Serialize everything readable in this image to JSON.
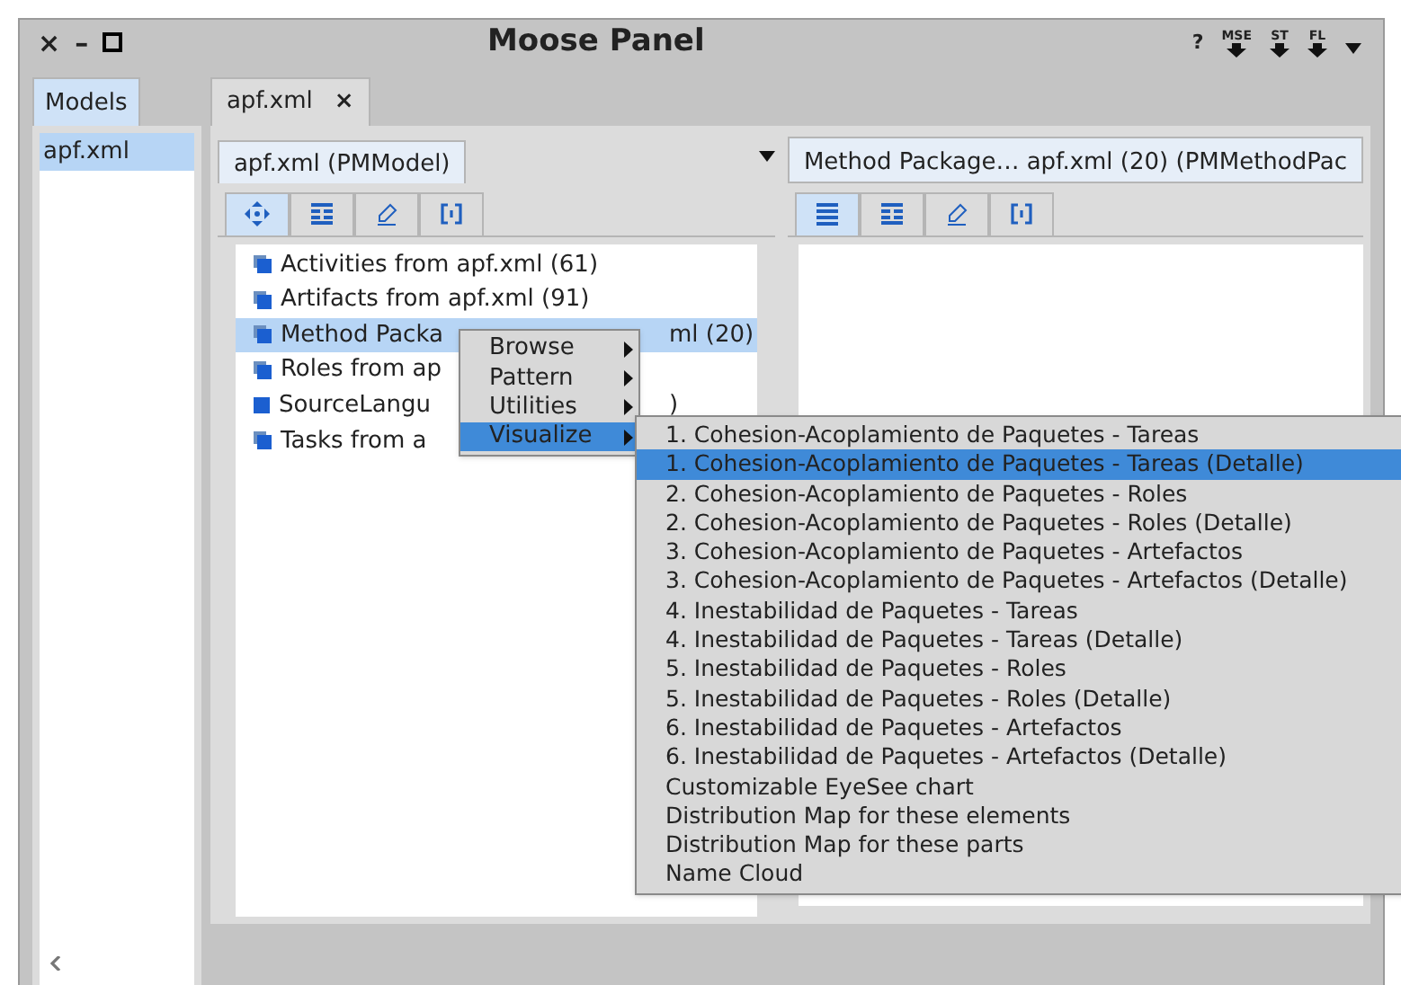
{
  "window": {
    "title": "Moose Panel",
    "controls": [
      "×",
      "–"
    ],
    "toolbar": [
      {
        "kind": "help",
        "label": "?"
      },
      {
        "kind": "export",
        "label": "MSE"
      },
      {
        "kind": "export",
        "label": "ST"
      },
      {
        "kind": "export",
        "label": "FL"
      },
      {
        "kind": "menu"
      }
    ]
  },
  "models": {
    "tab": "Models",
    "items": [
      {
        "label": "apf.xml",
        "selected": true
      }
    ]
  },
  "tabs": [
    {
      "label": "apf.xml",
      "close": "×",
      "selected": true
    }
  ],
  "left_pane": {
    "title": "apf.xml (PMModel)",
    "tools": [
      {
        "kind": "move",
        "selected": true
      },
      {
        "kind": "table",
        "selected": false
      },
      {
        "kind": "pen",
        "selected": false
      },
      {
        "kind": "brackets",
        "selected": false
      }
    ],
    "tree": [
      {
        "label": "Activities from apf.xml (61)",
        "kind": "group",
        "selected": false
      },
      {
        "label": "Artifacts from apf.xml (91)",
        "kind": "group",
        "selected": false
      },
      {
        "label": "Method Packa",
        "tail": "ml (20)",
        "kind": "group",
        "selected": true
      },
      {
        "label": "Roles from ap",
        "kind": "group",
        "selected": false
      },
      {
        "label": "SourceLangu",
        "tail": ")",
        "kind": "single",
        "selected": false
      },
      {
        "label": "Tasks from a",
        "kind": "group",
        "selected": false
      }
    ]
  },
  "right_pane": {
    "title": "Method Package… apf.xml (20) (PMMethodPac",
    "tools": [
      {
        "kind": "list",
        "selected": true
      },
      {
        "kind": "table",
        "selected": false
      },
      {
        "kind": "pen",
        "selected": false
      },
      {
        "kind": "brackets",
        "selected": false
      }
    ]
  },
  "context_menu": {
    "items": [
      {
        "label": "Browse",
        "selected": false
      },
      {
        "label": "Pattern",
        "selected": false
      },
      {
        "label": "Utilities",
        "selected": false
      },
      {
        "label": "Visualize",
        "selected": true
      }
    ]
  },
  "submenu": {
    "items": [
      {
        "label": "1. Cohesion-Acoplamiento de Paquetes -  Tareas",
        "selected": false
      },
      {
        "label": "1. Cohesion-Acoplamiento de Paquetes -  Tareas (Detalle)",
        "selected": true
      },
      {
        "label": "2. Cohesion-Acoplamiento de Paquetes -  Roles",
        "selected": false
      },
      {
        "label": "2. Cohesion-Acoplamiento de Paquetes -  Roles (Detalle)",
        "selected": false
      },
      {
        "label": "3. Cohesion-Acoplamiento de Paquetes -  Artefactos",
        "selected": false
      },
      {
        "label": "3. Cohesion-Acoplamiento de Paquetes -  Artefactos (Detalle)",
        "selected": false
      },
      {
        "label": "4. Inestabilidad de Paquetes - Tareas",
        "selected": false
      },
      {
        "label": "4. Inestabilidad de Paquetes - Tareas (Detalle)",
        "selected": false
      },
      {
        "label": "5. Inestabilidad de Paquetes - Roles",
        "selected": false
      },
      {
        "label": "5. Inestabilidad de Paquetes - Roles (Detalle)",
        "selected": false
      },
      {
        "label": "6. Inestabilidad de Paquetes - Artefactos",
        "selected": false
      },
      {
        "label": "6. Inestabilidad de Paquetes - Artefactos (Detalle)",
        "selected": false
      },
      {
        "label": "Customizable EyeSee chart",
        "selected": false
      },
      {
        "label": "Distribution Map for these elements",
        "selected": false
      },
      {
        "label": "Distribution Map for these parts",
        "selected": false
      },
      {
        "label": "Name Cloud",
        "selected": false
      }
    ]
  }
}
